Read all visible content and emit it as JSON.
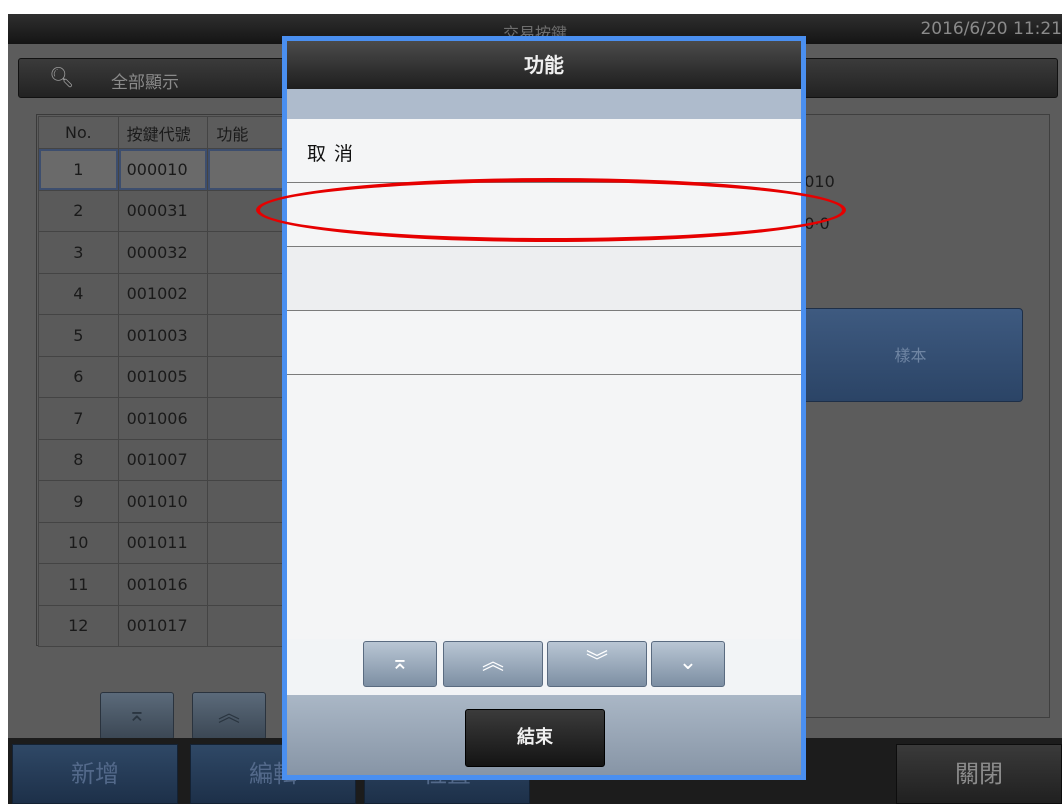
{
  "app": {
    "title": "交易按鍵",
    "datetime": "2016/6/20 11:21"
  },
  "search": {
    "icon": "search-icon",
    "filter_label": "全部顯示"
  },
  "table": {
    "headers": [
      "No.",
      "按鍵代號",
      "功能"
    ],
    "rows": [
      {
        "no": "1",
        "code": "000010"
      },
      {
        "no": "2",
        "code": "000031"
      },
      {
        "no": "3",
        "code": "000032"
      },
      {
        "no": "4",
        "code": "001002"
      },
      {
        "no": "5",
        "code": "001003"
      },
      {
        "no": "6",
        "code": "001005"
      },
      {
        "no": "7",
        "code": "001006"
      },
      {
        "no": "8",
        "code": "001007"
      },
      {
        "no": "9",
        "code": "001010"
      },
      {
        "no": "10",
        "code": "001011"
      },
      {
        "no": "11",
        "code": "001016"
      },
      {
        "no": "12",
        "code": "001017"
      }
    ],
    "selected_row": 1
  },
  "detail": {
    "value1": ")010",
    "value2": ")0·0",
    "sample_label": "樣本"
  },
  "pager": {
    "first_icon": "double-bar-up-icon",
    "up_icon": "double-chevron-up-icon"
  },
  "footer": {
    "add_label": "新增",
    "edit_label": "編輯",
    "position_label": "位置",
    "close_label": "關閉"
  },
  "dialog": {
    "title": "功能",
    "items": [
      "取消",
      "",
      "",
      ""
    ],
    "nav": {
      "top_glyph": "⌅",
      "up_glyph": "︽",
      "down_glyph": "︾",
      "bottom_glyph": "⌄"
    },
    "finish_label": "結束"
  },
  "colors": {
    "dialog_border": "#4a8ff0",
    "highlight": "#e60000",
    "footer_button": "#2f4866"
  }
}
